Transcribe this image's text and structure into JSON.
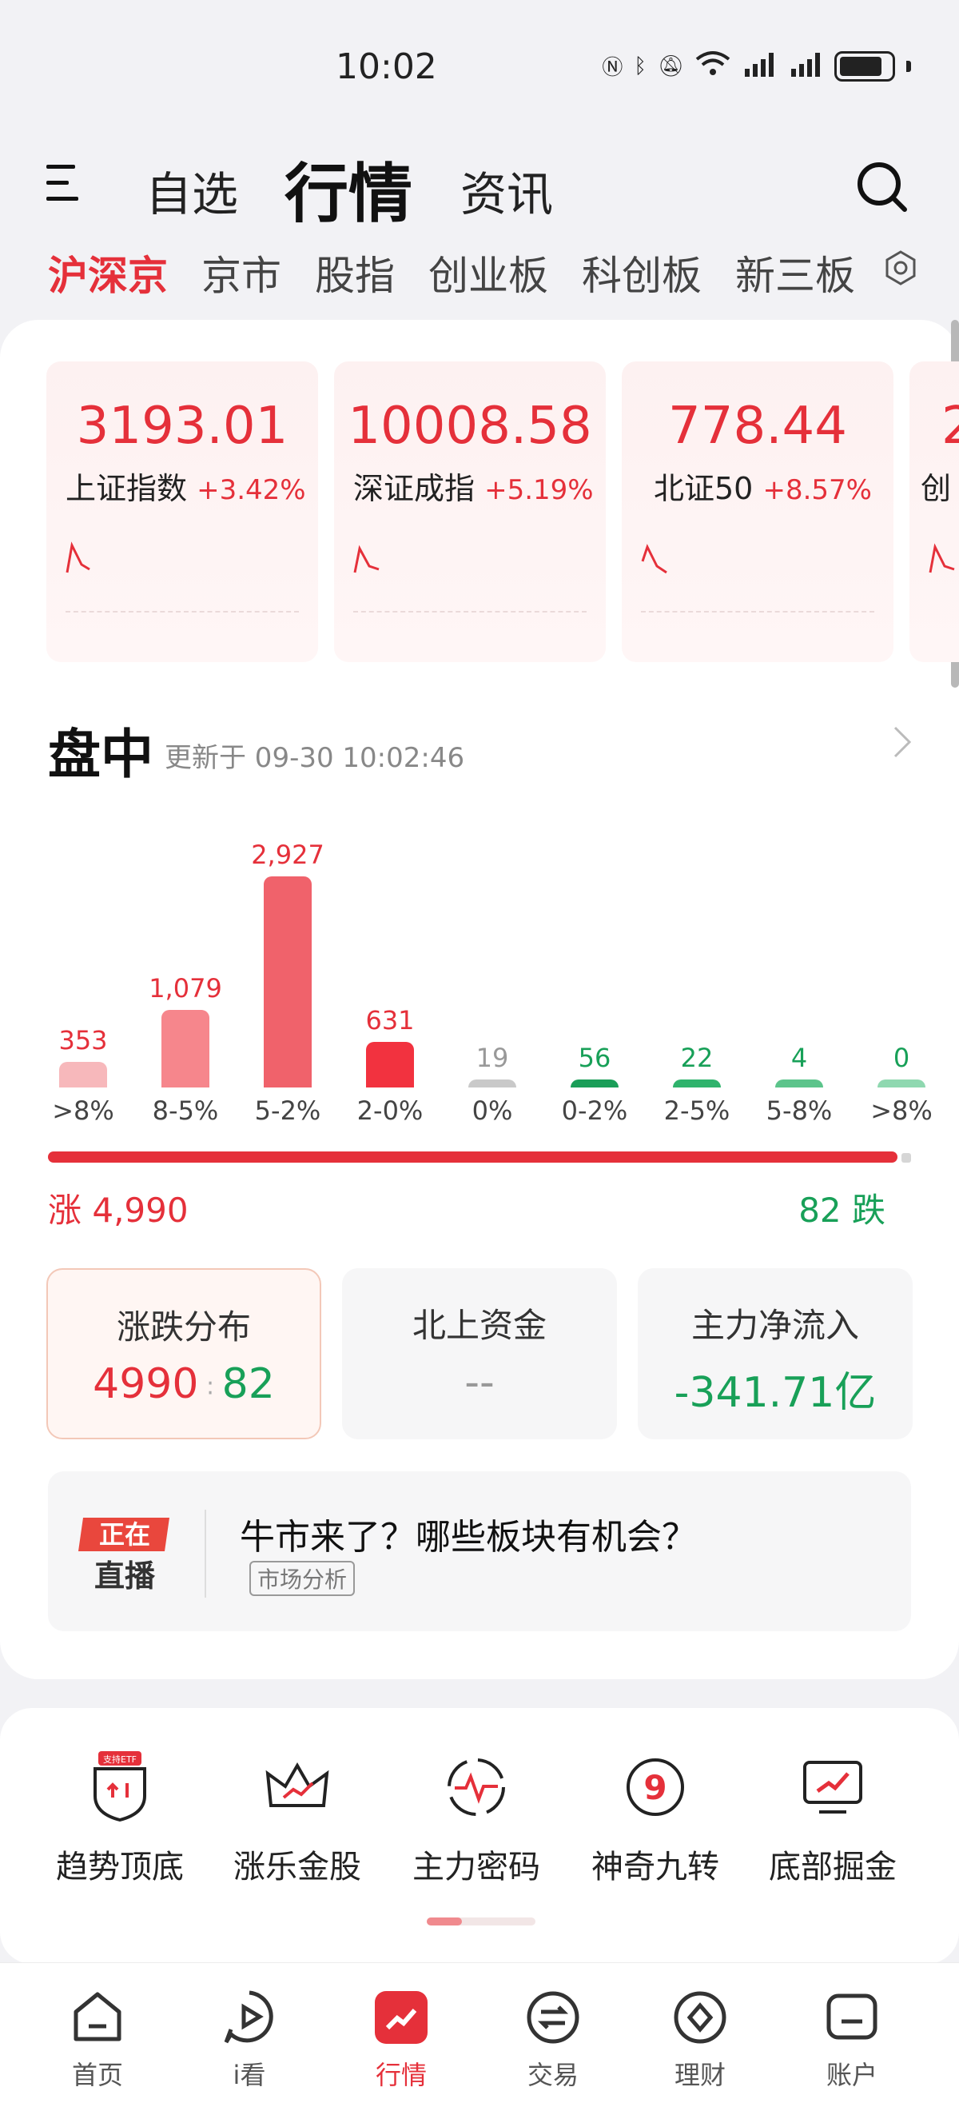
{
  "status_bar": {
    "time": "10:02"
  },
  "header": {
    "tabs": [
      {
        "label": "自选"
      },
      {
        "label": "行情"
      },
      {
        "label": "资讯"
      }
    ],
    "active_tab": "行情"
  },
  "subtabs": [
    "沪深京",
    "京市",
    "股指",
    "创业板",
    "科创板",
    "新三板"
  ],
  "indices": [
    {
      "value": "3193.01",
      "name": "上证指数",
      "change": "+3.42%"
    },
    {
      "value": "10008.58",
      "name": "深证成指",
      "change": "+5.19%"
    },
    {
      "value": "778.44",
      "name": "北证50",
      "change": "+8.57%"
    },
    {
      "value": "2",
      "name": "创",
      "change": ""
    }
  ],
  "intraday": {
    "title": "盘中",
    "update_text": "更新于 09-30 10:02:46"
  },
  "chart_data": {
    "type": "bar",
    "categories": [
      ">8%",
      "8-5%",
      "5-2%",
      "2-0%",
      "0%",
      "0-2%",
      "2-5%",
      "5-8%",
      ">8%"
    ],
    "values": [
      353,
      1079,
      2927,
      631,
      19,
      56,
      22,
      4,
      0
    ],
    "value_labels": [
      "353",
      "1,079",
      "2,927",
      "631",
      "19",
      "56",
      "22",
      "4",
      "0"
    ],
    "colors": [
      "#f7b8bb",
      "#f6868c",
      "#f0626b",
      "#f2323f",
      "#c9c9c9",
      "#1a9e58",
      "#2fb36c",
      "#5cc48b",
      "#8fd8b0"
    ],
    "label_colors": [
      "#e5303a",
      "#e5303a",
      "#e5303a",
      "#e5303a",
      "#999999",
      "#18a058",
      "#18a058",
      "#18a058",
      "#18a058"
    ],
    "ylim": [
      0,
      2927
    ]
  },
  "ratio": {
    "rise_label": "涨 4,990",
    "fall_label": "82 跌",
    "rise": 4990,
    "fall": 82
  },
  "stats": [
    {
      "title": "涨跌分布",
      "rise": "4990",
      "fall": "82"
    },
    {
      "title": "北上资金",
      "value": "--"
    },
    {
      "title": "主力净流入",
      "value": "-341.71亿"
    }
  ],
  "live": {
    "logo_top": "正在",
    "logo_bottom": "直播",
    "title": "牛市来了？哪些板块有机会？",
    "tag": "市场分析"
  },
  "tools": [
    {
      "label": "趋势顶底",
      "badge": "支持ETF"
    },
    {
      "label": "涨乐金股"
    },
    {
      "label": "主力密码"
    },
    {
      "label": "神奇九转"
    },
    {
      "label": "底部掘金"
    }
  ],
  "bottom_nav": [
    {
      "label": "首页"
    },
    {
      "label": "i看"
    },
    {
      "label": "行情"
    },
    {
      "label": "交易"
    },
    {
      "label": "理财"
    },
    {
      "label": "账户"
    }
  ],
  "colors": {
    "rise": "#e5303a",
    "fall": "#18a058",
    "accent": "#e5303a"
  }
}
